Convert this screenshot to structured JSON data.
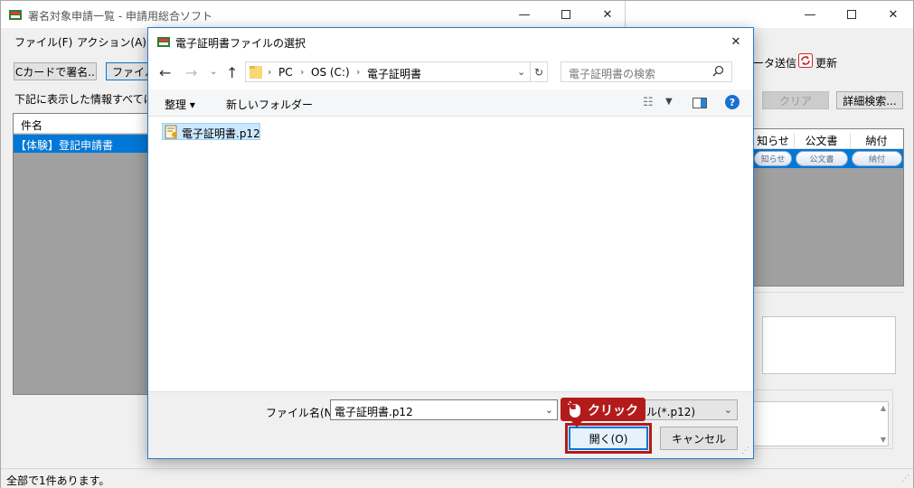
{
  "main_window": {
    "title": "署名対象申請一覧 - 申請用総合ソフト",
    "menu": [
      "ファイル(F)",
      "アクション(A)"
    ],
    "ic_sign_button": "ICカードで署名...",
    "file_sign_button_partial": "ファイルで",
    "info_text_partial": "下記に表示した情報すべてに署",
    "list_header": "件名",
    "list_rows": [
      "【体験】登記申請書"
    ],
    "status_text": "全部で1件あります。"
  },
  "right_panel": {
    "data_send_partial": "ータ送信",
    "refresh_label": "更新",
    "clear_button": "クリア",
    "detail_search_button": "詳細検索...",
    "columns": [
      "知らせ",
      "公文書",
      "納付"
    ],
    "row_buttons": [
      "知らせ",
      "公文書",
      "納付"
    ]
  },
  "dialog": {
    "title": "電子証明書ファイルの選択",
    "breadcrumb": [
      "PC",
      "OS (C:)",
      "電子証明書"
    ],
    "search_placeholder": "電子証明書の検索",
    "organize_label": "整理 ▾",
    "new_folder_label": "新しいフォルダー",
    "file_items": [
      "電子証明書.p12"
    ],
    "filename_label": "ファイル名(N):",
    "filename_value": "電子証明書.p12",
    "filetype_partial": "ル(*.p12)",
    "open_button": "開く(O)",
    "cancel_button": "キャンセル"
  },
  "callout": {
    "label": "クリック",
    "color": "#b31b1b"
  },
  "icons": {
    "minimize": "minimize-icon",
    "maximize": "maximize-icon",
    "close": "close-icon"
  }
}
